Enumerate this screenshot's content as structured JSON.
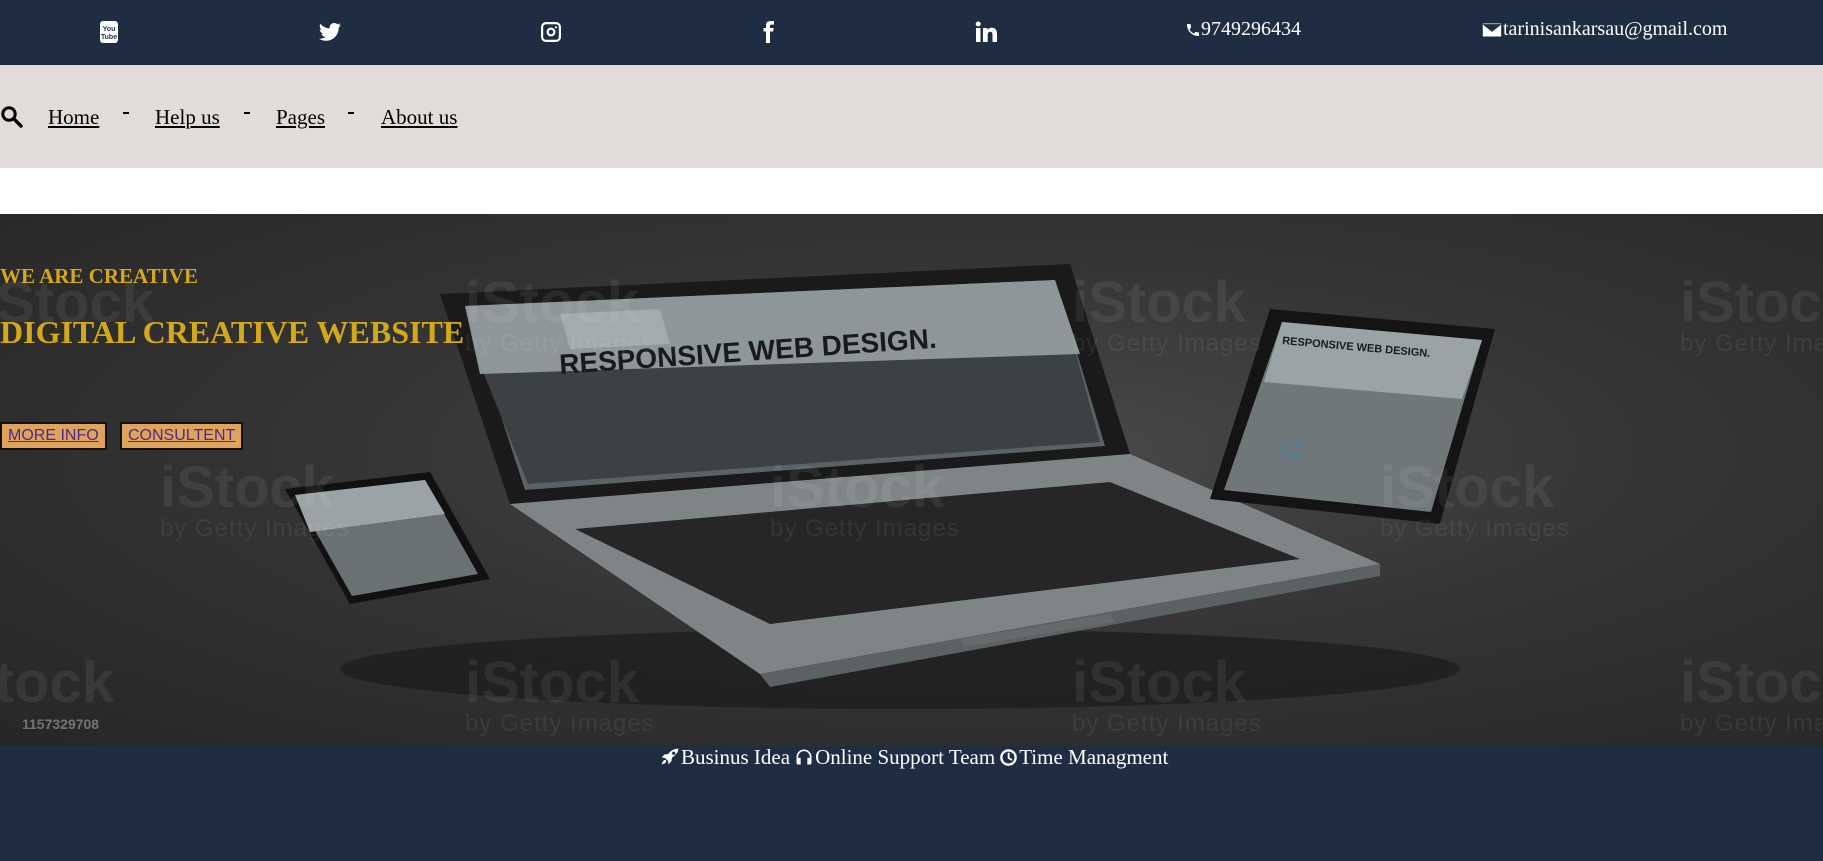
{
  "topbar": {
    "social_icons": [
      "youtube-icon",
      "twitter-icon",
      "instagram-icon",
      "facebook-icon",
      "linkedin-icon"
    ],
    "phone": "9749296434",
    "email": "tarinisankarsau@gmail.com"
  },
  "nav": {
    "items": [
      {
        "label": "Home"
      },
      {
        "label": "Help us"
      },
      {
        "label": "Pages"
      },
      {
        "label": "About us"
      }
    ]
  },
  "hero": {
    "kicker": "WE ARE CREATIVE",
    "headline": "DIGITAL CREATIVE WEBSITE",
    "buttons": [
      {
        "label": "MORE INFO"
      },
      {
        "label": "CONSULTENT"
      }
    ],
    "image_text": {
      "laptop_screen": "RESPONSIVE WEB DESIGN.",
      "tablet_screen": "RESPONSIVE WEB DESIGN.",
      "watermark": "iStock",
      "watermark_sub": "by Getty Images",
      "stock_id": "1157329708"
    }
  },
  "footer": {
    "features": [
      {
        "icon": "rocket-icon",
        "label": "Businus Idea"
      },
      {
        "icon": "headphones-icon",
        "label": "Online Support Team"
      },
      {
        "icon": "clock-icon",
        "label": "Time Managment"
      }
    ]
  },
  "colors": {
    "topbar_bg": "#1f2d43",
    "navbar_bg": "#e1dcda",
    "accent_gold": "#d4a81c",
    "button_bg": "#e0a35c",
    "button_text": "#4b2a8a"
  }
}
